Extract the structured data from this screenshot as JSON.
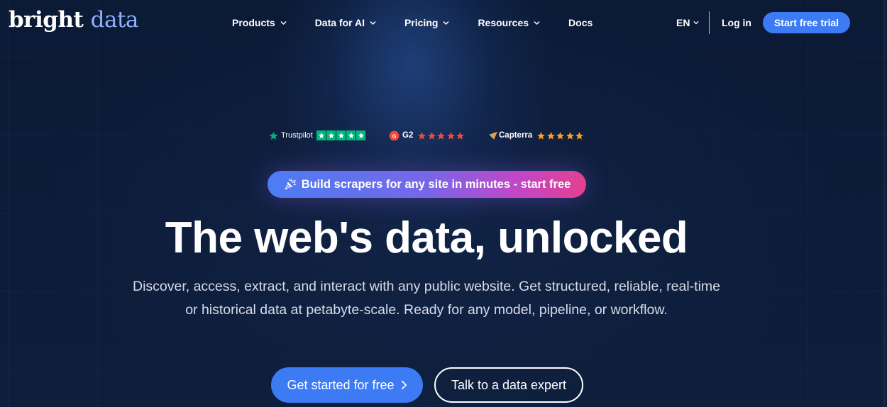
{
  "logo": {
    "part1": "bright",
    "part2": "data"
  },
  "nav": {
    "items": [
      {
        "label": "Products",
        "has_dropdown": true
      },
      {
        "label": "Data for AI",
        "has_dropdown": true
      },
      {
        "label": "Pricing",
        "has_dropdown": true
      },
      {
        "label": "Resources",
        "has_dropdown": true
      },
      {
        "label": "Docs",
        "has_dropdown": false
      }
    ],
    "language": "EN",
    "login": "Log in",
    "cta": "Start free trial"
  },
  "ratings": [
    {
      "name": "Trustpilot",
      "icon": "trustpilot-star-icon",
      "stars": 5
    },
    {
      "name": "G2",
      "icon": "g2-logo-icon",
      "stars": 5
    },
    {
      "name": "Capterra",
      "icon": "capterra-logo-icon",
      "stars": 5
    }
  ],
  "promo": {
    "icon": "party-popper-icon",
    "text": "Build scrapers for any site in minutes - start free"
  },
  "hero": {
    "title": "The web's data, unlocked",
    "subtitle_line1": "Discover, access, extract, and interact with any public website. Get structured, reliable, real-time",
    "subtitle_line2": "or historical data at petabyte-scale. Ready for any model, pipeline, or workflow."
  },
  "cta": {
    "primary": "Get started for free",
    "secondary": "Talk to a data expert"
  },
  "colors": {
    "background": "#0c1a33",
    "accent_blue": "#3d7bf5",
    "logo_accent": "#8fb2ff",
    "trustpilot_green": "#00b67a",
    "g2_red": "#ef4a3d",
    "capterra_orange": "#ff9d28",
    "promo_gradient_start": "#4c7df4",
    "promo_gradient_end": "#e4408f"
  }
}
